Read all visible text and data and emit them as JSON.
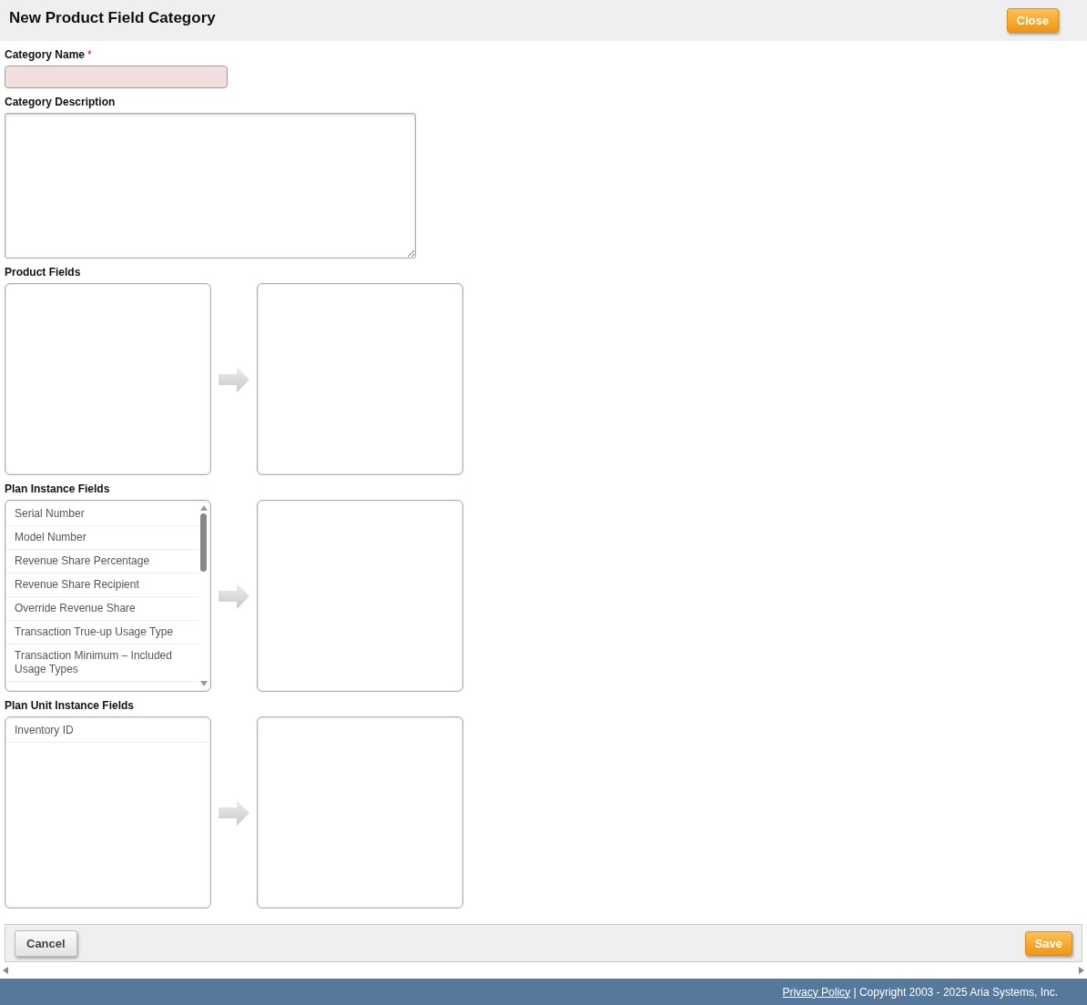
{
  "header": {
    "title": "New Product Field Category",
    "close_button": "Close"
  },
  "category_name": {
    "label": "Category Name",
    "required_mark": "*",
    "invalid": true
  },
  "category_description": {
    "label": "Category Description"
  },
  "field_groups": [
    {
      "label": "Product Fields"
    },
    {
      "label": "Plan Instance Fields",
      "available": [
        "Serial Number",
        "Model Number",
        "Revenue Share Percentage",
        "Revenue Share Recipient",
        "Override Revenue Share",
        "Transaction True-up Usage Type",
        "Transaction Minimum – Included Usage Types"
      ],
      "scrollable": true
    },
    {
      "label": "Plan Unit Instance Fields",
      "available": [
        "Inventory ID"
      ]
    }
  ],
  "actions": {
    "cancel": "Cancel",
    "save": "Save"
  },
  "footer": {
    "link": "Privacy Policy",
    "text": "| Copyright 2003 - 2025 Aria Systems, Inc."
  }
}
